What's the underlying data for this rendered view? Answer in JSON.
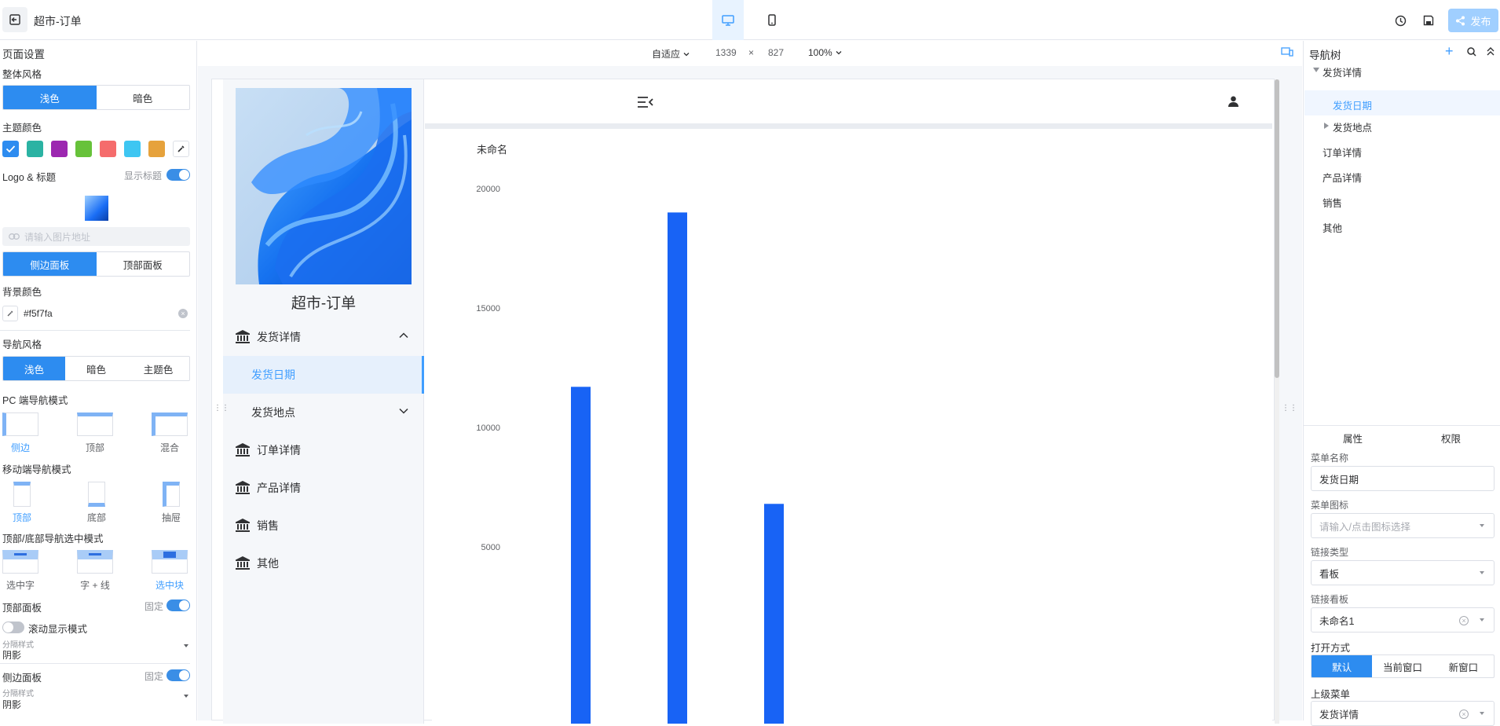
{
  "header": {
    "title": "超市-订单",
    "publish_label": "发布"
  },
  "left_panel": {
    "section_title": "页面设置",
    "overall_style_label": "整体风格",
    "overall_style_options": [
      "浅色",
      "暗色"
    ],
    "theme_color_label": "主题颜色",
    "theme_colors": [
      "#2d8cf0",
      "#2bb3a3",
      "#9c27b0",
      "#67c23a",
      "#f56c6c",
      "#3ec6f2",
      "#e6a23c"
    ],
    "logo_title_label": "Logo & 标题",
    "show_title_label": "显示标题",
    "image_url_placeholder": "请输入图片地址",
    "panel_options": [
      "侧边面板",
      "顶部面板"
    ],
    "bg_color_label": "背景颜色",
    "bg_color_value": "#f5f7fa",
    "nav_style_label": "导航风格",
    "nav_style_options": [
      "浅色",
      "暗色",
      "主题色"
    ],
    "pc_nav_mode_label": "PC 端导航模式",
    "pc_nav_modes": [
      "侧边",
      "顶部",
      "混合"
    ],
    "mobile_nav_mode_label": "移动端导航模式",
    "mobile_nav_modes": [
      "顶部",
      "底部",
      "抽屉"
    ],
    "select_mode_label": "顶部/底部导航选中模式",
    "select_modes": [
      "选中字",
      "字 + 线",
      "选中块"
    ],
    "top_panel_label": "顶部面板",
    "fixed_label": "固定",
    "scroll_show_label": "滚动显示模式",
    "divider_style_label": "分隔样式",
    "divider_style_value": "阴影",
    "side_panel_label": "侧边面板",
    "side_fixed_label": "固定",
    "side_divider_style_label": "分隔样式",
    "side_divider_style_value": "阴影"
  },
  "center": {
    "fit_label": "自适应",
    "width": "1339",
    "times": "×",
    "height": "827",
    "zoom": "100%",
    "preview": {
      "site_title": "超市-订单",
      "menu": [
        {
          "label": "发货详情"
        },
        {
          "label": "发货日期"
        },
        {
          "label": "发货地点"
        },
        {
          "label": "订单详情"
        },
        {
          "label": "产品详情"
        },
        {
          "label": "销售"
        },
        {
          "label": "其他"
        }
      ]
    }
  },
  "chart_data": {
    "type": "bar",
    "title": "未命名",
    "categories": [
      "",
      "",
      ""
    ],
    "values": [
      11700,
      19000,
      6800
    ],
    "yticks": [
      "20000",
      "15000",
      "10000",
      "5000"
    ],
    "ylim": [
      0,
      20000
    ],
    "color": "#1863f5",
    "grid": false
  },
  "right_panel": {
    "tree_title": "导航树",
    "tree": [
      "发货详情",
      "发货日期",
      "发货地点",
      "订单详情",
      "产品详情",
      "销售",
      "其他"
    ],
    "tabs": [
      "属性",
      "权限"
    ],
    "menu_name_label": "菜单名称",
    "menu_name_value": "发货日期",
    "menu_icon_label": "菜单图标",
    "menu_icon_placeholder": "请输入/点击图标选择",
    "link_type_label": "链接类型",
    "link_type_value": "看板",
    "link_board_label": "链接看板",
    "link_board_value": "未命名1",
    "open_mode_label": "打开方式",
    "open_modes": [
      "默认",
      "当前窗口",
      "新窗口"
    ],
    "parent_menu_label": "上级菜单",
    "parent_menu_value": "发货详情"
  }
}
